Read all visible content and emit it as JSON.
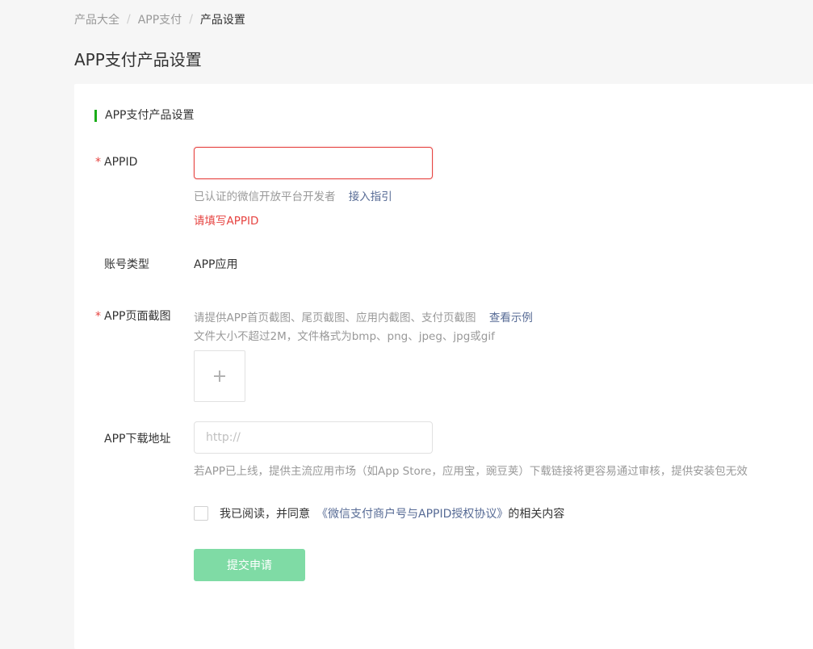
{
  "breadcrumb": {
    "items": [
      "产品大全",
      "APP支付",
      "产品设置"
    ],
    "separator": "/"
  },
  "page_title": "APP支付产品设置",
  "section_title": "APP支付产品设置",
  "form": {
    "appid": {
      "label": "APPID",
      "required_mark": "*",
      "value": "",
      "hint": "已认证的微信开放平台开发者",
      "hint_link": "接入指引",
      "error": "请填写APPID"
    },
    "account_type": {
      "label": "账号类型",
      "value": "APP应用"
    },
    "screenshot": {
      "label": "APP页面截图",
      "required_mark": "*",
      "hint": "请提供APP首页截图、尾页截图、应用内截图、支付页截图",
      "hint_link": "查看示例",
      "hint2": "文件大小不超过2M，文件格式为bmp、png、jpeg、jpg或gif",
      "upload_icon": "plus-icon"
    },
    "download_url": {
      "label": "APP下载地址",
      "placeholder": "http://",
      "value": "",
      "hint": "若APP已上线，提供主流应用市场（如App Store，应用宝，豌豆荚）下载链接将更容易通过审核，提供安装包无效"
    },
    "agreement": {
      "checked": false,
      "prefix": "我已阅读，并同意",
      "link": "《微信支付商户号与APPID授权协议》",
      "suffix": "的相关内容"
    },
    "submit_label": "提交申请"
  },
  "colors": {
    "accent": "#1aad19",
    "error": "#e64340",
    "link": "#576b95",
    "submit_disabled": "#7fdba5"
  }
}
